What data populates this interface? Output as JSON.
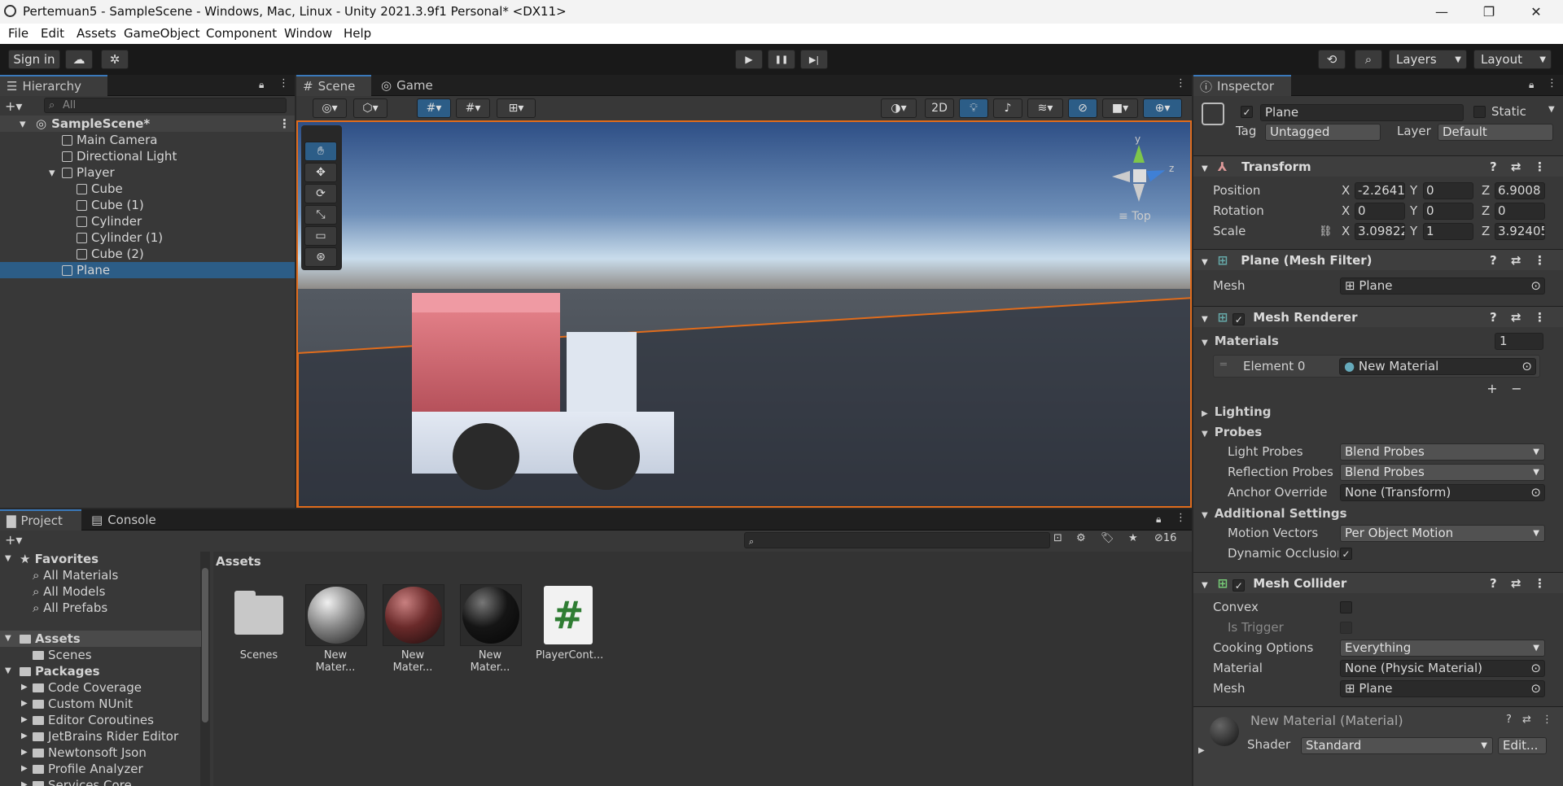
{
  "window": {
    "title": "Pertemuan5 - SampleScene - Windows, Mac, Linux - Unity 2021.3.9f1 Personal* <DX11>",
    "minimize": "—",
    "maximize": "❐",
    "close": "✕"
  },
  "menu": [
    "File",
    "Edit",
    "Assets",
    "GameObject",
    "Component",
    "Window",
    "Help"
  ],
  "toolbar": {
    "signin": "Sign in",
    "play": "▶",
    "pause": "❚❚",
    "step": "▶|",
    "layers": "Layers",
    "layout": "Layout"
  },
  "hierarchy": {
    "tab": "Hierarchy",
    "search_placeholder": "All",
    "scene": "SampleScene*",
    "items": [
      {
        "label": "Main Camera"
      },
      {
        "label": "Directional Light"
      },
      {
        "label": "Player"
      },
      {
        "label": "Cube"
      },
      {
        "label": "Cube (1)"
      },
      {
        "label": "Cylinder"
      },
      {
        "label": "Cylinder (1)"
      },
      {
        "label": "Cube (2)"
      },
      {
        "label": "Plane"
      }
    ]
  },
  "scene": {
    "tab_scene": "Scene",
    "tab_game": "Game",
    "mode_2d": "2D",
    "gizmo_top": "Top",
    "gizmo_y": "y",
    "gizmo_z": "z"
  },
  "inspector": {
    "tab": "Inspector",
    "object_name": "Plane",
    "static": "Static",
    "tag_label": "Tag",
    "tag": "Untagged",
    "layer_label": "Layer",
    "layer": "Default",
    "transform": {
      "title": "Transform",
      "position": "Position",
      "rotation": "Rotation",
      "scale": "Scale",
      "pos": [
        "-2.2641",
        "0",
        "6.9008"
      ],
      "rot": [
        "0",
        "0",
        "0"
      ],
      "scl": [
        "3.09822",
        "1",
        "3.92405"
      ],
      "x": "X",
      "y": "Y",
      "z": "Z"
    },
    "mesh_filter": {
      "title": "Plane (Mesh Filter)",
      "mesh_label": "Mesh",
      "mesh": "Plane"
    },
    "mesh_renderer": {
      "title": "Mesh Renderer",
      "materials": "Materials",
      "count": "1",
      "element": "Element 0",
      "material": "New Material",
      "plus": "+",
      "minus": "−",
      "lighting": "Lighting",
      "probes": "Probes",
      "light_probes": "Light Probes",
      "light_probes_val": "Blend Probes",
      "refl_probes": "Reflection Probes",
      "refl_probes_val": "Blend Probes",
      "anchor": "Anchor Override",
      "anchor_val": "None (Transform)",
      "additional": "Additional Settings",
      "motion": "Motion Vectors",
      "motion_val": "Per Object Motion",
      "dynocc": "Dynamic Occlusion"
    },
    "mesh_collider": {
      "title": "Mesh Collider",
      "convex": "Convex",
      "trigger": "Is Trigger",
      "cooking": "Cooking Options",
      "cooking_val": "Everything",
      "material": "Material",
      "material_val": "None (Physic Material)",
      "mesh": "Mesh",
      "mesh_val": "Plane"
    },
    "material": {
      "title": "New Material (Material)",
      "shader_label": "Shader",
      "shader": "Standard",
      "edit": "Edit..."
    }
  },
  "project": {
    "tab_project": "Project",
    "tab_console": "Console",
    "count": "16",
    "breadcrumb": "Assets",
    "tree": [
      {
        "label": "Favorites"
      },
      {
        "label": "All Materials"
      },
      {
        "label": "All Models"
      },
      {
        "label": "All Prefabs"
      },
      {
        "label": "Assets"
      },
      {
        "label": "Scenes"
      },
      {
        "label": "Packages"
      },
      {
        "label": "Code Coverage"
      },
      {
        "label": "Custom NUnit"
      },
      {
        "label": "Editor Coroutines"
      },
      {
        "label": "JetBrains Rider Editor"
      },
      {
        "label": "Newtonsoft Json"
      },
      {
        "label": "Profile Analyzer"
      },
      {
        "label": "Services Core"
      }
    ],
    "assets": [
      {
        "label": "Scenes"
      },
      {
        "label": "New Mater..."
      },
      {
        "label": "New Mater..."
      },
      {
        "label": "New Mater..."
      },
      {
        "label": "PlayerCont..."
      }
    ]
  },
  "colors": {
    "accent": "#3a79bb",
    "selection": "#2c5d87",
    "outline": "#e06c1c"
  }
}
